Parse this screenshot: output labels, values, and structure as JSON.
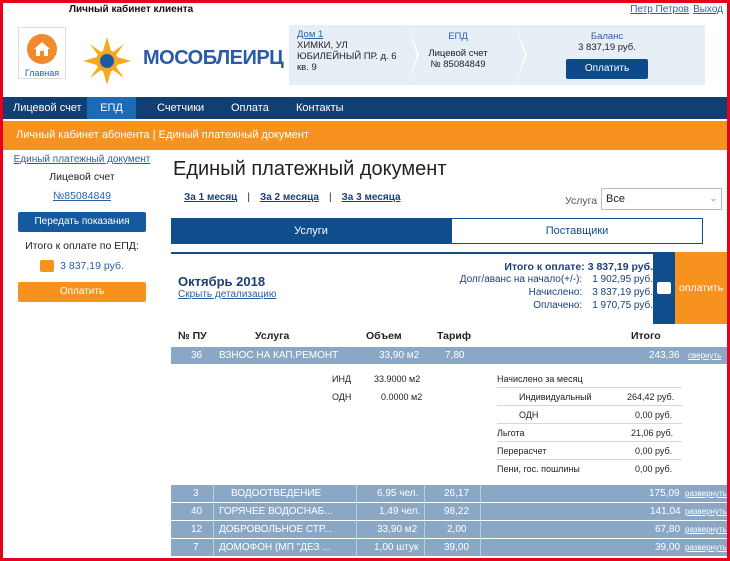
{
  "topbar": {
    "title": "Личный кабинет клиента",
    "user": "Петр Петров",
    "exit": "Выход"
  },
  "home": {
    "label": "Главная",
    "icon": "home-icon"
  },
  "logo": {
    "text": "МОСОБЛЕИРЦ"
  },
  "crumbs": {
    "address": {
      "head": "Дом 1",
      "line1": "ХИМКИ, УЛ",
      "line2": "ЮБИЛЕЙНЫЙ ПР. д. 6",
      "line3": "кв. 9"
    },
    "epd": {
      "head": "ЕПД",
      "line1": "Лицевой счет",
      "line2": "№ 85084849"
    },
    "balance": {
      "head": "Баланс",
      "value": "3 837,19 руб.",
      "button": "Оплатить"
    }
  },
  "nav": {
    "items": [
      "Лицевой счет",
      "ЕПД",
      "Счетчики",
      "Оплата",
      "Контакты"
    ],
    "active": "ЕПД"
  },
  "subbar": {
    "text": "Личный кабинет абонента | Единый платежный документ"
  },
  "left": {
    "link": "Единый платежный документ",
    "account_label": "Лицевой счет",
    "account_number": "№85084849",
    "readings_button": "Передать показания",
    "total_label": "Итого к оплате по ЕПД:",
    "total_value": "3 837,19 руб.",
    "pay_button": "Оплатить"
  },
  "main": {
    "title": "Единый платежный документ",
    "periods": [
      "За 1 месяц",
      "За 2 месяца",
      "За 3 месяца"
    ],
    "service_label": "Услуга",
    "service_value": "Все",
    "tabs": [
      "Услуги",
      "Поставщики"
    ],
    "period": "Октябрь  2018",
    "hide_details": "Скрыть детализацию",
    "totals": {
      "to_pay_label": "Итого к оплате:",
      "to_pay": "3 837,19 руб.",
      "debt_label": "Долг/аванс на начало(+/-):",
      "debt": "1 902,95 руб.",
      "charged_label": "Начислено:",
      "charged": "3 837,19 руб.",
      "paid_label": "Оплачено:",
      "paid": "1 970,75 руб."
    },
    "pay_label": "оплатить",
    "columns": [
      "№ ПУ",
      "Услуга",
      "Объем",
      "Тариф",
      "Итого"
    ],
    "rows": [
      {
        "pu": "36",
        "service": "ВЗНОС НА КАП.РЕМОНТ",
        "volume": "33,90 м2",
        "tariff": "7,80",
        "total": "243,36",
        "action": "свернуть"
      },
      {
        "pu": "3",
        "service": "ВОДООТВЕДЕНИЕ",
        "volume": "6,95 чел.",
        "tariff": "26,17",
        "total": "175,09",
        "action": "развернуть"
      },
      {
        "pu": "40",
        "service": "ГОРЯЧЕЕ ВОДОСНАБ...",
        "volume": "1,49 чел.",
        "tariff": "98,22",
        "total": "141,04",
        "action": "развернуть"
      },
      {
        "pu": "12",
        "service": "ДОБРОВОЛЬНОЕ СТР...",
        "volume": "33,90 м2",
        "tariff": "2,00",
        "total": "67,80",
        "action": "развернуть"
      },
      {
        "pu": "7",
        "service": "ДОМОФОН (МП \"ДЕЗ ...",
        "volume": "1,00 штук",
        "tariff": "39,00",
        "total": "39,00",
        "action": "развернуть"
      }
    ],
    "detail": {
      "ind_label": "ИНД",
      "ind_value": "33.9000 м2",
      "odn_label": "ОДН",
      "odn_value": "0.0000 м2",
      "accrued_title": "Начислено за месяц",
      "individual_label": "Индивидуальный",
      "individual_value": "264,42 руб.",
      "odn2_label": "ОДН",
      "odn2_value": "0,00 руб.",
      "benefit_label": "Льгота",
      "benefit_value": "21,06 руб.",
      "recalc_label": "Перерасчет",
      "recalc_value": "0,00 руб.",
      "fines_label": "Пени, гос. пошлины",
      "fines_value": "0,00 руб."
    }
  }
}
